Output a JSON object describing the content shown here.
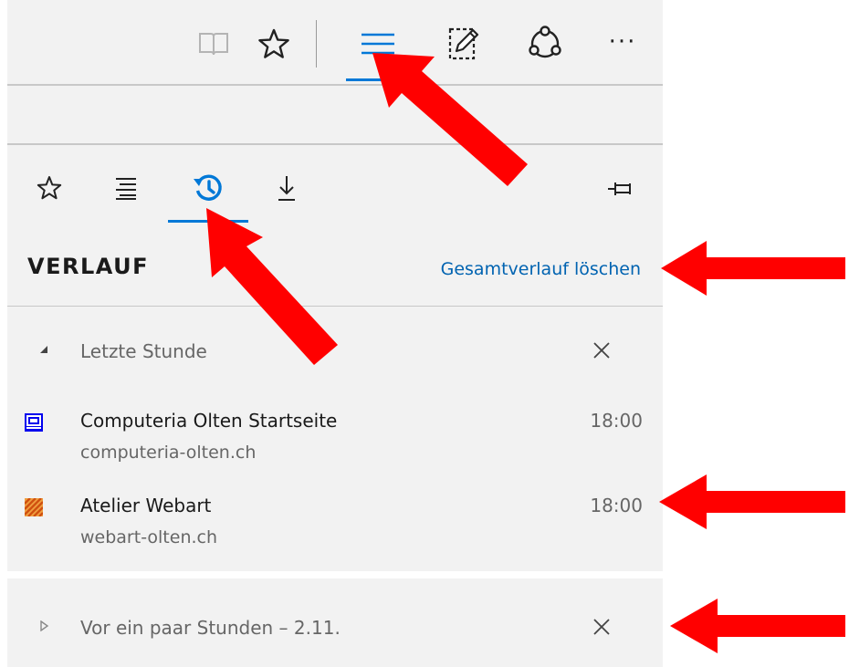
{
  "toolbar": {
    "icons": [
      "reading-view-icon",
      "favorite-star-icon",
      "hub-icon",
      "web-note-icon",
      "share-icon",
      "more-icon"
    ],
    "more_label": "···"
  },
  "hub": {
    "tabs": [
      "favorites-tab",
      "reading-list-tab",
      "history-tab",
      "downloads-tab"
    ],
    "active_tab": "history-tab",
    "pin_icon": "pin-icon"
  },
  "history": {
    "title": "VERLAUF",
    "clear_all": "Gesamtverlauf löschen",
    "groups": [
      {
        "label": "Letzte Stunde",
        "expanded": true,
        "items": [
          {
            "title": "Computeria Olten Startseite",
            "url": "computeria-olten.ch",
            "time": "18:00"
          },
          {
            "title": "Atelier Webart",
            "url": "webart-olten.ch",
            "time": "18:00"
          }
        ]
      },
      {
        "label": "Vor ein paar Stunden – 2.11.",
        "expanded": false,
        "items": []
      }
    ]
  },
  "colors": {
    "accent": "#0078d7",
    "link": "#0063b1",
    "annotation_arrow": "#ff0000",
    "panel_bg": "#f2f2f2"
  }
}
